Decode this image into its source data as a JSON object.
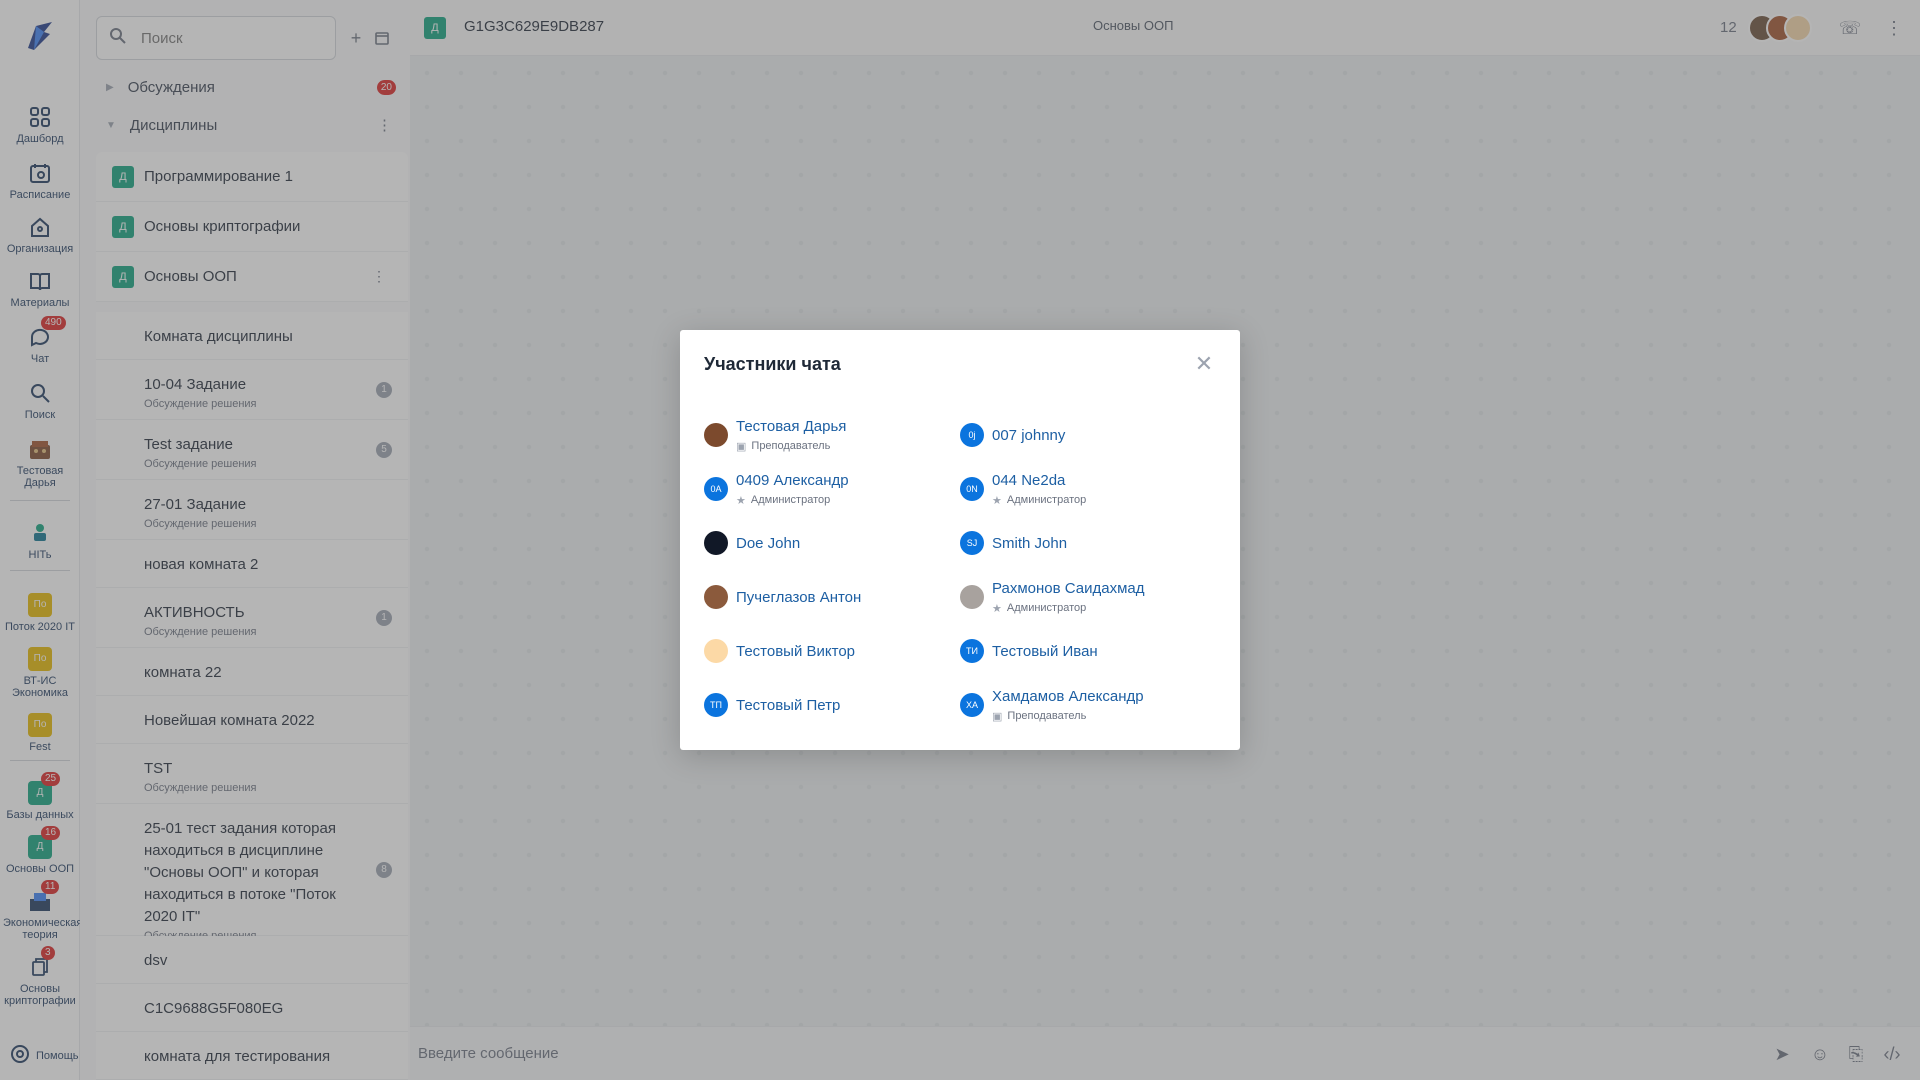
{
  "rail": {
    "items": [
      {
        "label": "Дашборд",
        "icon": "dashboard-icon"
      },
      {
        "label": "Расписание",
        "icon": "calendar-icon"
      },
      {
        "label": "Организация",
        "icon": "organization-icon"
      },
      {
        "label": "Материалы",
        "icon": "book-icon"
      },
      {
        "label": "Чат",
        "icon": "chat-icon",
        "badge": "490"
      },
      {
        "label": "Поиск",
        "icon": "search-icon"
      },
      {
        "label": "Тестовая Дарья",
        "icon": "user-avatar"
      },
      {
        "label": "НIТь",
        "icon": "hits-icon"
      },
      {
        "label": "Поток 2020 IT",
        "tag": "По"
      },
      {
        "label": "ВТ-ИС Экономика",
        "tag": "По"
      },
      {
        "label": "Fest",
        "tag": "По"
      },
      {
        "label": "Базы данных",
        "tag": "Д",
        "badge": "25"
      },
      {
        "label": "Основы ООП",
        "tag": "Д",
        "badge": "16"
      },
      {
        "label": "Экономическая теория",
        "badge": "11"
      },
      {
        "label": "Основы криптографии",
        "badge": "3"
      }
    ],
    "help": "Помощь"
  },
  "sidebar": {
    "search_placeholder": "Поиск",
    "groups": [
      {
        "label": "Обсуждения",
        "count": "20"
      },
      {
        "label": "Дисциплины"
      }
    ],
    "disciplines": [
      {
        "tag": "Д",
        "label": "Программирование 1"
      },
      {
        "tag": "Д",
        "label": "Основы криптографии"
      },
      {
        "tag": "Д",
        "label": "Основы ООП"
      }
    ],
    "rooms": [
      {
        "title": "Комната дисциплины",
        "sub": "",
        "count": ""
      },
      {
        "title": "10-04 Задание",
        "sub": "Обсуждение решения",
        "count": "1"
      },
      {
        "title": "Test задание",
        "sub": "Обсуждение решения",
        "count": "5"
      },
      {
        "title": "27-01 Задание",
        "sub": "Обсуждение решения",
        "count": ""
      },
      {
        "title": "новая комната 2",
        "sub": "",
        "count": ""
      },
      {
        "title": "АКТИВНОСТЬ",
        "sub": "Обсуждение решения",
        "count": "1"
      },
      {
        "title": "комната 22",
        "sub": "",
        "count": ""
      },
      {
        "title": "Новейшая комната 2022",
        "sub": "",
        "count": ""
      },
      {
        "title": "TST",
        "sub": "Обсуждение решения",
        "count": ""
      },
      {
        "title": "25-01 тест задания которая находиться в дисциплине \"Основы ООП\" и которая находиться в потоке \"Поток 2020 IT\"",
        "sub": "Обсуждение решения",
        "count": "8"
      },
      {
        "title": "dsv",
        "sub": "",
        "count": ""
      },
      {
        "title": "C1C9688G5F080EG",
        "sub": "",
        "count": ""
      },
      {
        "title": "комната для тестирования",
        "sub": "",
        "count": ""
      }
    ]
  },
  "topbar": {
    "tag": "Д",
    "title": "G1G3C629E9DB287",
    "center": "Основы ООП",
    "participants_count": "12"
  },
  "composer": {
    "placeholder": "Введите сообщение"
  },
  "modal": {
    "title": "Участники чата",
    "members": [
      {
        "name": "Тестовая Дарья",
        "role": "Преподаватель",
        "role_icon": "briefcase-icon",
        "initials": "",
        "photo": true
      },
      {
        "name": "007 johnny",
        "role": "",
        "initials": "0j"
      },
      {
        "name": "0409 Александр",
        "role": "Администратор",
        "role_icon": "star-icon",
        "initials": "0А"
      },
      {
        "name": "044 Ne2da",
        "role": "Администратор",
        "role_icon": "star-icon",
        "initials": "0N"
      },
      {
        "name": "Doe John",
        "role": "",
        "initials": "",
        "photo": true
      },
      {
        "name": "Smith John",
        "role": "",
        "initials": "SJ"
      },
      {
        "name": "Пучеглазов Антон",
        "role": "",
        "initials": "",
        "photo": true
      },
      {
        "name": "Рахмонов Саидахмад",
        "role": "Администратор",
        "role_icon": "star-icon",
        "initials": "",
        "photo": true
      },
      {
        "name": "Тестовый Виктор",
        "role": "",
        "initials": "",
        "photo": true
      },
      {
        "name": "Тестовый Иван",
        "role": "",
        "initials": "ТИ"
      },
      {
        "name": "Тестовый Петр",
        "role": "",
        "initials": "ТП"
      },
      {
        "name": "Хамдамов Александр",
        "role": "Преподаватель",
        "role_icon": "briefcase-icon",
        "initials": "ХА"
      }
    ]
  },
  "colors": {
    "accent": "#0b74de",
    "discipline_tag": "#10a37f",
    "badge": "#dc2626",
    "stream_tag": "#e6b800"
  }
}
